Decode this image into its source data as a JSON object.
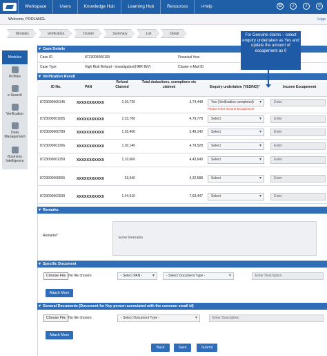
{
  "nav": {
    "items": [
      "Workspace",
      "Users",
      "Knowledge Hub",
      "Learning Hub",
      "Resources",
      "i-Help"
    ],
    "icons": [
      "settings-icon",
      "bell-icon",
      "info-icon",
      "user-icon"
    ]
  },
  "welcome": {
    "text": "Welcome, POOLANGL",
    "logout": "Logo"
  },
  "breadcrumbs": [
    "Modules",
    "Verification",
    "Cluster",
    "Summary",
    "List",
    "Detail"
  ],
  "sidebar": [
    {
      "label": "Modules",
      "icon": "modules-icon"
    },
    {
      "label": "Profiles",
      "icon": "profiles-icon"
    },
    {
      "label": "e-Search",
      "icon": "search-icon"
    },
    {
      "label": "Verification",
      "icon": "verification-icon"
    },
    {
      "label": "Data Management",
      "icon": "data-management-icon"
    },
    {
      "label": "Business Intelligence",
      "icon": "business-intelligence-icon"
    }
  ],
  "callout": "For Genuine claims – select enquiry undertaken as Yes and update the amount of escapement as 0",
  "case": {
    "title": "Case Details",
    "case_id_label": "Case ID",
    "case_id": "8723000000109",
    "fy_label": "Financial Year",
    "fy": "",
    "type_label": "Case Type",
    "type": "High Risk Refund - Investigation(HRR-INV)",
    "cluster_label": "Cluster e-Mail ID",
    "cluster": ""
  },
  "verification": {
    "title": "Verification Result",
    "headers": {
      "id": "ID No.",
      "pan": "PAN",
      "refund": "Refund Claimed",
      "total": "Total deductions, exemptions etc claimed",
      "enquiry": "Enquiry undertaken (YES/NO)*",
      "income": "Income Escapement"
    },
    "rows": [
      {
        "id": "8723000006145",
        "pan": "XXXXXXXXXXX",
        "refund": "2,20,720",
        "total": "3,74,448",
        "enquiry": "Yes (Verification completed)",
        "income": "Enter",
        "error": "Please enter Income Escapement"
      },
      {
        "id": "8723000001005",
        "pan": "XXXXXXXXXXX",
        "refund": "2,33,760",
        "total": "4,79,778",
        "enquiry": "Select",
        "income": "Enter"
      },
      {
        "id": "8723000000789",
        "pan": "XXXXXXXXXXX",
        "refund": "1,20,460",
        "total": "5,49,142",
        "enquiry": "Select",
        "income": "Enter"
      },
      {
        "id": "8723000001266",
        "pan": "XXXXXXXXXXX",
        "refund": "1,30,140",
        "total": "4,79,528",
        "enquiry": "Select",
        "income": "Enter"
      },
      {
        "id": "8723000001259",
        "pan": "XXXXXXXXXXX",
        "refund": "1,10,600",
        "total": "4,43,640",
        "enquiry": "Select",
        "income": "Enter"
      },
      {
        "id": "8723000006655",
        "pan": "XXXXXXXXXXX",
        "refund": "53,640",
        "total": "4,32,588",
        "enquiry": "Select",
        "income": "Enter"
      },
      {
        "id": "8723000002930",
        "pan": "XXXXXXXXXXX",
        "refund": "1,44,510",
        "total": "7,63,447",
        "enquiry": "Select",
        "income": "Enter"
      }
    ]
  },
  "remarks": {
    "title": "Remarks",
    "label": "Remarks*",
    "placeholder": "Enter Remarks"
  },
  "specific": {
    "title": "Specific Document",
    "choose": "Choose File",
    "nofile": "No file chosen",
    "pan_select": "- Select PAN -",
    "doc_select": "- Select Document Type -",
    "desc": "Enter Description",
    "attach": "Attach More"
  },
  "general": {
    "title": "General Documents (Document for Key person associated with the common email id)",
    "choose": "Choose File",
    "nofile": "No file chosen",
    "doc_select": "- Select Document Type -",
    "desc": "Enter Description",
    "attach": "Attach More"
  },
  "actions": {
    "back": "Back",
    "save": "Save",
    "submit": "Submit"
  }
}
